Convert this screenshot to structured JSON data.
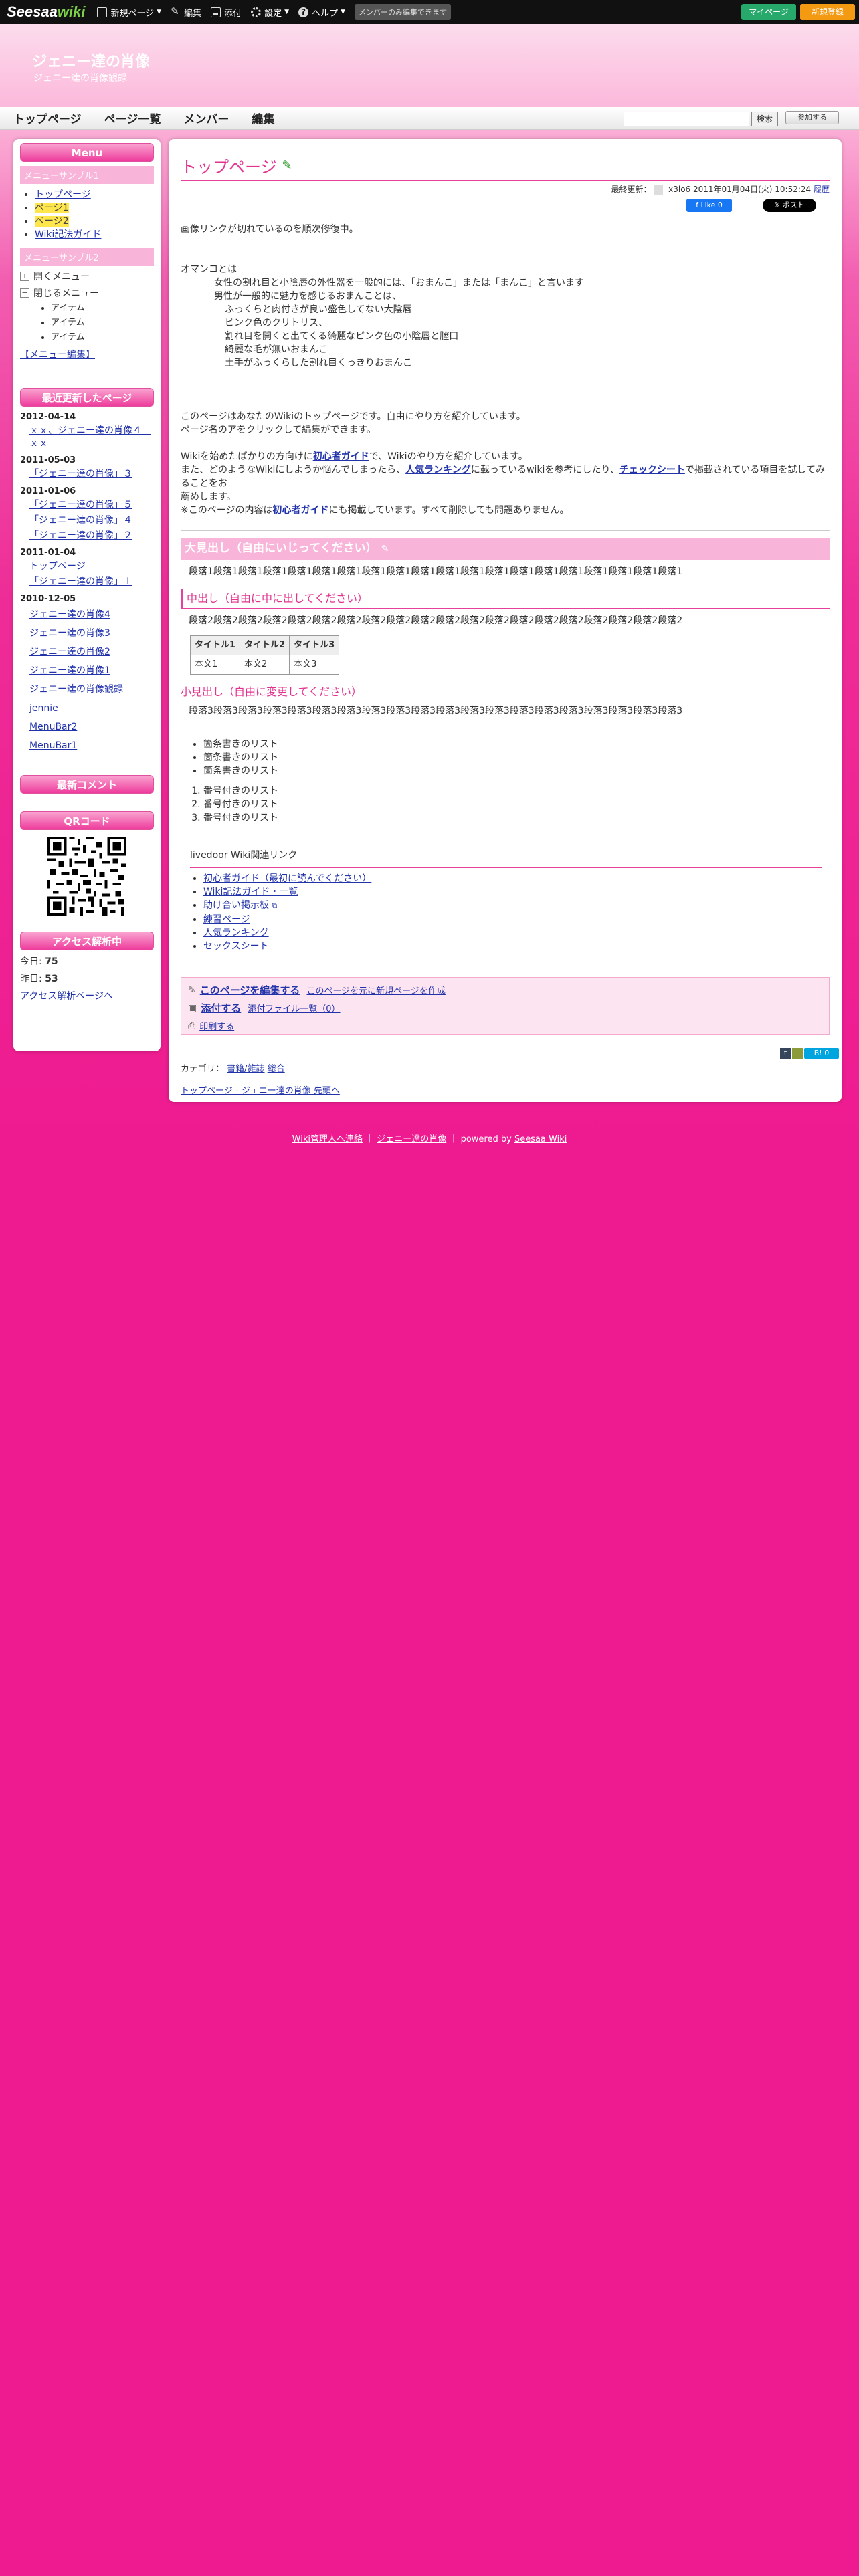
{
  "topbar": {
    "logo_part1": "Seesaa",
    "logo_part2": "wiki",
    "new_page": "新規ページ",
    "edit": "編集",
    "attach": "添付",
    "settings": "設定",
    "help": "ヘルプ",
    "note": "メンバーのみ編集できます",
    "mypage": "マイページ",
    "register": "新規登録"
  },
  "header": {
    "title": "ジェニー達の肖像",
    "subtitle": "ジェニー達の肖像観録"
  },
  "gnav": {
    "items": [
      "トップページ",
      "ページ一覧",
      "メンバー",
      "編集"
    ],
    "search_button": "検索",
    "join_button": "参加する"
  },
  "sidebar": {
    "menu_title": "Menu",
    "sample1": "メニューサンプル1",
    "sample1_items": [
      "トップページ",
      "ページ1",
      "ページ2",
      "Wiki記法ガイド"
    ],
    "sample2": "メニューサンプル2",
    "open_menu": "開くメニュー",
    "close_menu": "閉じるメニュー",
    "tree_items": [
      "アイテム",
      "アイテム",
      "アイテム"
    ],
    "menu_edit": "【メニュー編集】",
    "recent_title": "最近更新したページ",
    "recent": [
      {
        "date": "2012-04-14",
        "links": [
          "ｘｘ、ジェニー達の肖像４　ｘｘ"
        ]
      },
      {
        "date": "2011-05-03",
        "links": [
          "「ジェニー達の肖像」３"
        ]
      },
      {
        "date": "2011-01-06",
        "links": [
          "「ジェニー達の肖像」５",
          "「ジェニー達の肖像」４",
          "「ジェニー達の肖像」２"
        ]
      },
      {
        "date": "2011-01-04",
        "links": [
          "トップページ",
          "「ジェニー達の肖像」１"
        ]
      },
      {
        "date": "2010-12-05",
        "links": [
          "ジェニー達の肖像4",
          "ジェニー達の肖像3",
          "ジェニー達の肖像2",
          "ジェニー達の肖像1",
          "ジェニー達の肖像観録",
          "jennie",
          "MenuBar2",
          "MenuBar1"
        ]
      }
    ],
    "comments_title": "最新コメント",
    "qr_title": "QRコード",
    "access_title": "アクセス解析中",
    "today_label": "今日:",
    "today_value": "75",
    "yesterday_label": "昨日:",
    "yesterday_value": "53",
    "access_link": "アクセス解析ページへ"
  },
  "main": {
    "page_title": "トップページ",
    "updated_label": "最終更新：",
    "updated_user": "x3lo6",
    "updated_time": "2011年01月04日(火) 10:52:24",
    "history": "履歴",
    "fb_like": "Like 0",
    "x_post": "ポスト",
    "intro": "画像リンクが切れているのを順次修復中。",
    "omanko": [
      "オマンコとは",
      "女性の割れ目と小陰唇の外性器を一般的には、「おまんこ」または「まんこ」と言います",
      "男性が一般的に魅力を感じるおまんことは、",
      "ふっくらと肉付きが良い盛色してない大陰唇",
      "ピンク色のクリトリス、",
      "割れ目を開くと出てくる綺麗なピンク色の小陰唇と膣口",
      "綺麗な毛が無いおまんこ",
      "土手がふっくらした割れ目くっきりおまんこ"
    ],
    "welcome1": "このページはあなたのWikiのトップページです。自由にやり方を紹介しています。",
    "welcome2": "ページ名のアをクリックして編集ができます。",
    "guide1_a": "Wikiを始めたばかりの方向けに",
    "guide1_link": "初心者ガイド",
    "guide1_b": "で、Wikiのやり方を紹介しています。",
    "guide2_a": "また、どのようなWikiにしようか悩んでしまったら、",
    "guide2_link1": "人気ランキング",
    "guide2_b": "に載っているwikiを参考にしたり、",
    "guide2_link2": "チェックシート",
    "guide2_c": "で掲載されている項目を試してみることをお",
    "guide2_d": "薦めします。",
    "guide3_a": "※このページの内容は",
    "guide3_link": "初心者ガイド",
    "guide3_b": "にも掲載しています。すべて削除しても問題ありません。",
    "h_big": "大見出し（自由にいじってください）",
    "para1": "段落1段落1段落1段落1段落1段落1段落1段落1段落1段落1段落1段落1段落1段落1段落1段落1段落1段落1段落1段落1",
    "h_mid": "中出し（自由に中に出してください）",
    "para2": "段落2段落2段落2段落2段落2段落2段落2段落2段落2段落2段落2段落2段落2段落2段落2段落2段落2段落2段落2段落2",
    "table": {
      "headers": [
        "タイトル1",
        "タイトル2",
        "タイトル3"
      ],
      "cells": [
        "本文1",
        "本文2",
        "本文3"
      ]
    },
    "h_small": "小見出し（自由に変更してください）",
    "para3": "段落3段落3段落3段落3段落3段落3段落3段落3段落3段落3段落3段落3段落3段落3段落3段落3段落3段落3段落3段落3",
    "bullets": [
      "箇条書きのリスト",
      "箇条書きのリスト",
      "箇条書きのリスト"
    ],
    "numbered": [
      "番号付きのリスト",
      "番号付きのリスト",
      "番号付きのリスト"
    ],
    "link_title": "livedoor Wiki関連リンク",
    "links": [
      "初心者ガイド（最初に読んでください）",
      "Wiki記法ガイド・一覧",
      "助け合い掲示板",
      "練習ページ",
      "人気ランキング",
      "セックスシート"
    ],
    "edit_page": "このページを編集する",
    "new_from_page": "このページを元に新規ページを作成",
    "attach": "添付する",
    "attach_list": "添付ファイル一覧（0）",
    "print": "印刷する",
    "share_hatena": "B! 0",
    "category_label": "カテゴリ：",
    "categories": [
      "書籍/雑誌",
      "総合"
    ],
    "breadcrumb": "トップページ - ジェニー達の肖像 先頭へ"
  },
  "footer": {
    "report": "Wiki管理人へ連絡",
    "site": "ジェニー達の肖像",
    "powered": "powered by",
    "seesaa": "Seesaa Wiki"
  }
}
